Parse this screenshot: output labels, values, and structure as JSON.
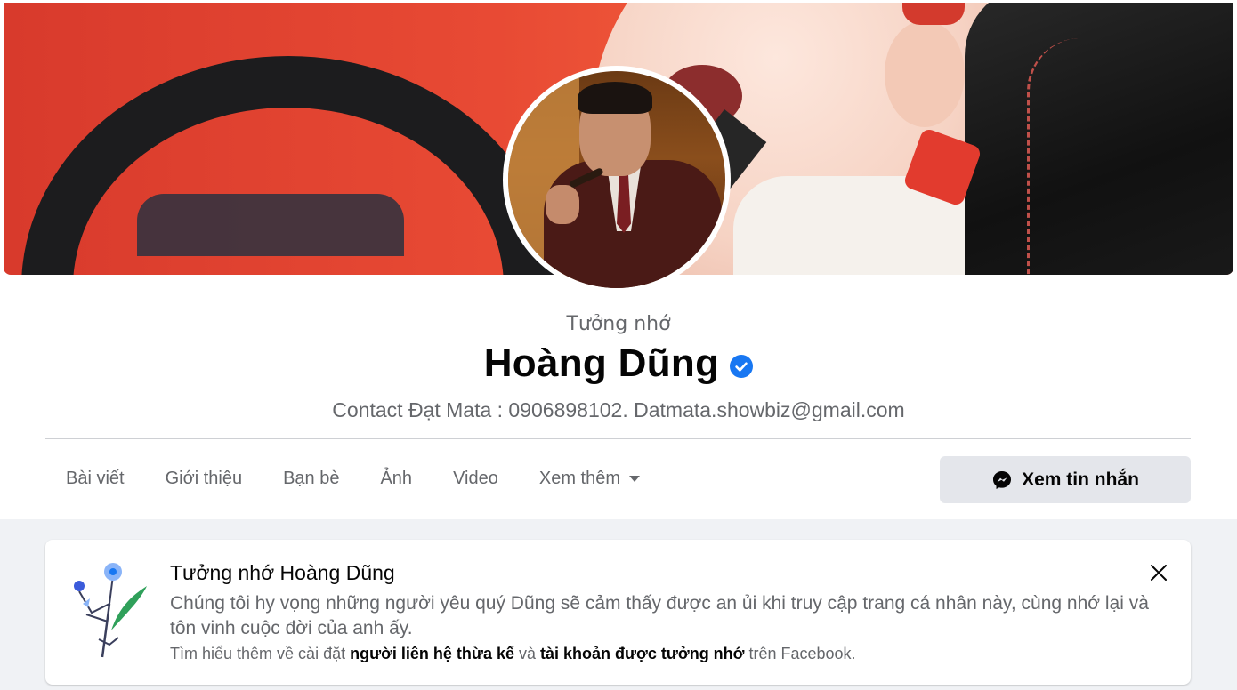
{
  "profile": {
    "memorial_label": "Tưởng nhớ",
    "name": "Hoàng Dũng",
    "bio": "Contact Đạt Mata : 0906898102. Datmata.showbiz@gmail.com",
    "verified_icon": "verified-badge-icon"
  },
  "tabs": [
    {
      "label": "Bài viết"
    },
    {
      "label": "Giới thiệu"
    },
    {
      "label": "Bạn bè"
    },
    {
      "label": "Ảnh"
    },
    {
      "label": "Video"
    },
    {
      "label": "Xem thêm"
    }
  ],
  "actions": {
    "message_label": "Xem tin nhắn",
    "message_icon": "messenger-icon"
  },
  "memorial_card": {
    "title": "Tưởng nhớ Hoàng Dũng",
    "body": "Chúng tôi hy vọng những người yêu quý Dũng sẽ cảm thấy được an ủi khi truy cập trang cá nhân này, cùng nhớ lại và tôn vinh cuộc đời của anh ấy.",
    "foot_prefix": "Tìm hiểu thêm về cài đặt ",
    "legacy_link": "người liên hệ thừa kế",
    "foot_middle": " và ",
    "memorial_link": "tài khoản được tưởng nhớ",
    "foot_suffix": " trên Facebook."
  },
  "colors": {
    "accent": "#1877f2",
    "text_primary": "#050505",
    "text_secondary": "#65676b",
    "page_bg": "#f0f2f5"
  }
}
